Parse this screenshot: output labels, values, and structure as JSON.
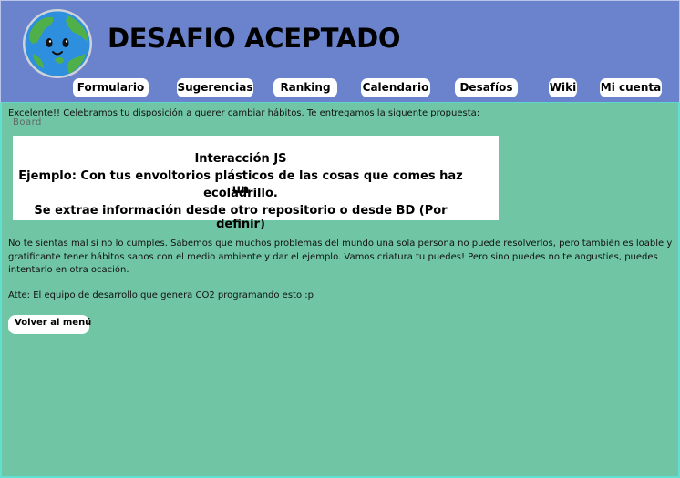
{
  "header": {
    "title": "DESAFIO ACEPTADO",
    "logo_icon": "earth-globe-smiling-icon"
  },
  "nav": {
    "items": [
      {
        "label": "Formulario"
      },
      {
        "label": "Sugerencias"
      },
      {
        "label": "Ranking"
      },
      {
        "label": "Calendario"
      },
      {
        "label": "Desafíos"
      },
      {
        "label": "Wiki"
      },
      {
        "label": "Mi cuenta"
      }
    ]
  },
  "content": {
    "intro": "Excelente!! Celebramos tu disposición a querer cambiar hábitos. Te entregamos la siguente propuesta:",
    "board_label": "Board",
    "board": {
      "line1": "Interacción JS",
      "line2a": "Ejemplo: Con tus envoltorios plásticos de las cosas que comes haz un",
      "line2b": "ecoladrillo.",
      "line3": "Se extrae información desde otro repositorio o desde BD (Por definir)"
    },
    "paragraph": "No te sientas mal si no lo cumples. Sabemos que muchos problemas del mundo una sola persona no puede resolverlos, pero también es loable y gratificante tener hábitos sanos con el medio ambiente y dar el ejemplo. Vamos criatura tu puedes! Pero sino puedes no te angusties, puedes intentarlo en otra ocación.",
    "signature": "Atte: El equipo de desarrollo que genera CO2 programando esto :p",
    "back_button": "Volver al menú"
  },
  "colors": {
    "header_bg": "#6b83cc",
    "main_bg": "#70c5a5",
    "border_accent": "#5fe0d2"
  }
}
